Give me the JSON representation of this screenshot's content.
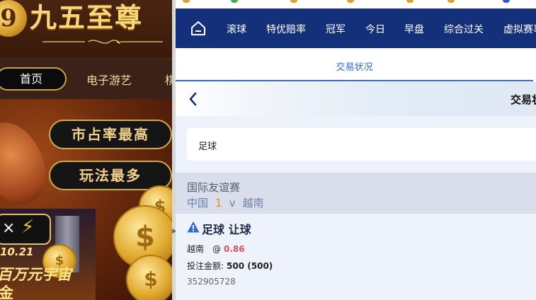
{
  "promo": {
    "logo_badge": "9",
    "logo_text": "九五至尊",
    "nav": {
      "home": "首页",
      "games": "电子游艺",
      "more": "棋"
    },
    "pills": [
      "市占率最高",
      "玩法最多"
    ],
    "event": {
      "x": "×",
      "bolt": "⚡",
      "date": "10.21",
      "title": "百万元宇宙",
      "title2": "金"
    },
    "coin_symbol": "$"
  },
  "app": {
    "navbar": {
      "home_icon": "home-icon",
      "items": [
        "滚球",
        "特优赔率",
        "冠军",
        "今日",
        "早盘",
        "综合过关",
        "虚拟赛事"
      ]
    },
    "tab": {
      "label": "交易状况"
    },
    "title_bar": {
      "title": "交易状况"
    },
    "filter": {
      "sport": "足球"
    },
    "league": {
      "name": "国际友谊赛",
      "home": "中国",
      "score": "1",
      "vs": "v",
      "away": "越南"
    },
    "bet": {
      "icon": "warning-icon",
      "title": "足球 让球",
      "selection": "越南",
      "at": "@",
      "odds": "0.86",
      "amount_label": "投注金额:",
      "amount_value": "500 (500)",
      "bet_id": "352905728"
    }
  },
  "colors": {
    "navbar": "#14307a",
    "accent": "#2a6ad6",
    "odds": "#e0505a",
    "score": "#e08a2a",
    "league_bg": "#d9deea",
    "gold": "#f3d08a"
  }
}
